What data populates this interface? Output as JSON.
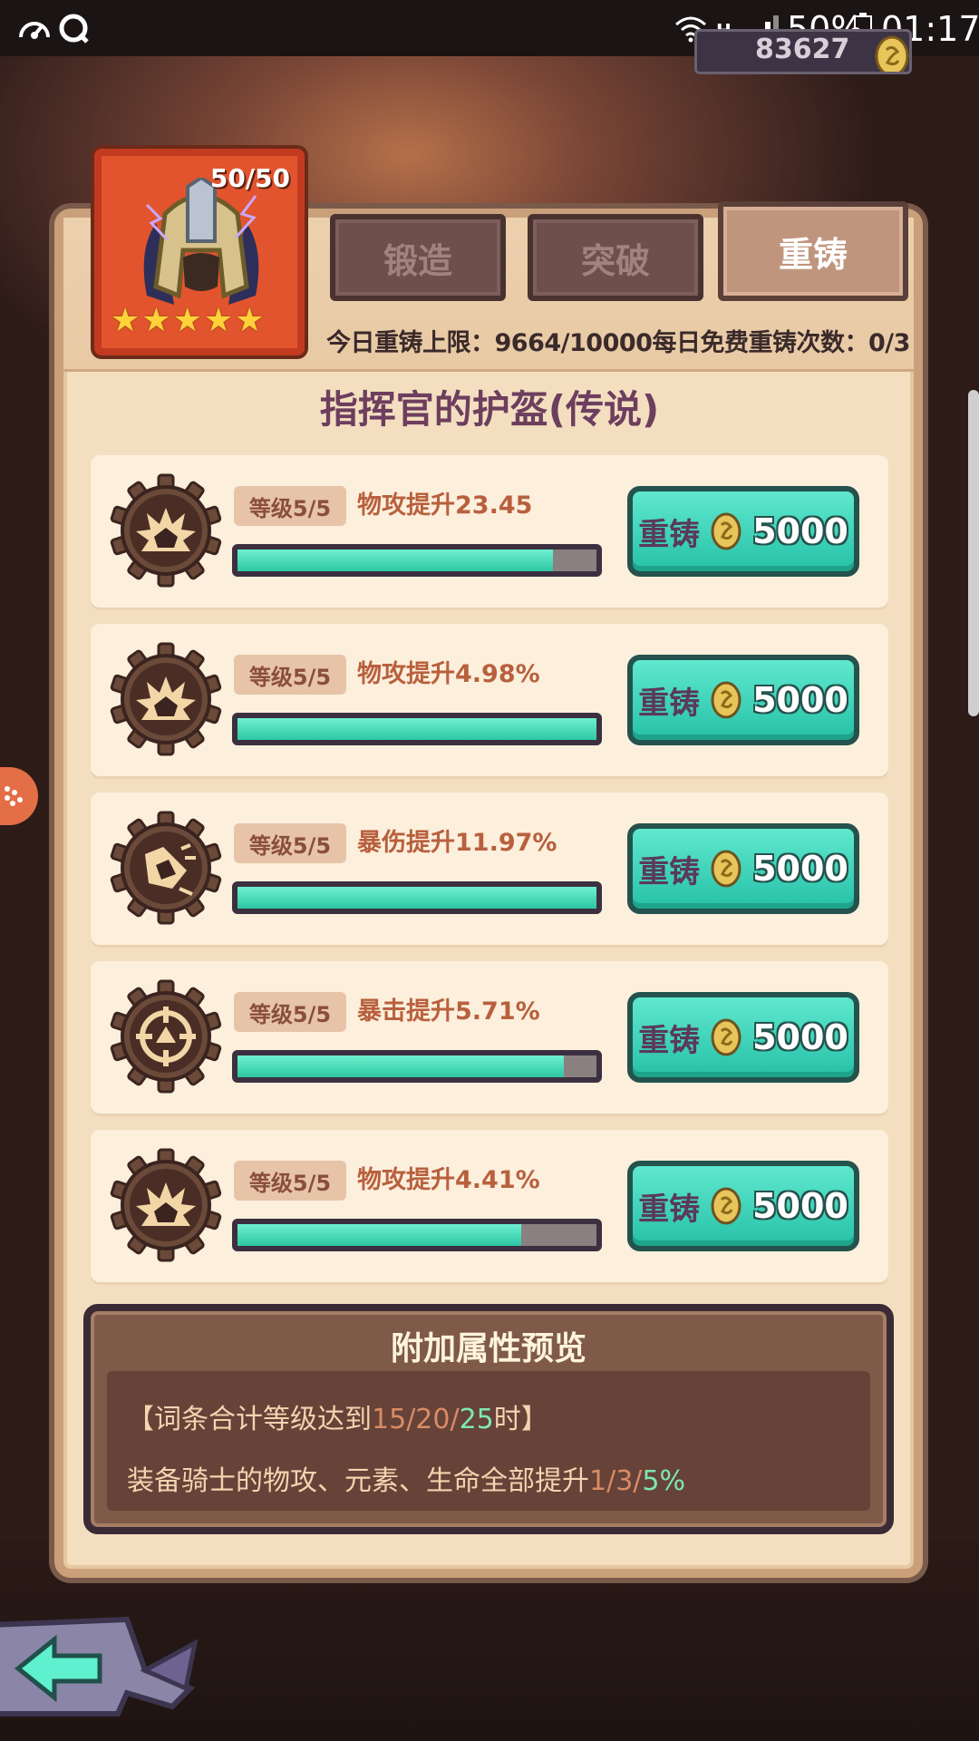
{
  "status_bar": {
    "network_type": "H",
    "battery": "50%",
    "time": "01:17"
  },
  "currency": {
    "amount": "83627"
  },
  "item": {
    "level": "50/50",
    "stars": 5,
    "title": "指挥官的护盔(传说)"
  },
  "tabs": [
    {
      "label": "锻造"
    },
    {
      "label": "突破"
    },
    {
      "label": "重铸"
    }
  ],
  "active_tab": "重铸",
  "limits": {
    "text": "今日重铸上限：9664/10000每日免费重铸次数：0/3"
  },
  "affixes": [
    {
      "level": "等级5/5",
      "stat": "物攻提升23.45",
      "progress": 0.88,
      "icon": "attack-burst-icon",
      "button": "重铸",
      "cost": "5000"
    },
    {
      "level": "等级5/5",
      "stat": "物攻提升4.98%",
      "progress": 1.0,
      "icon": "attack-burst-icon",
      "button": "重铸",
      "cost": "5000"
    },
    {
      "level": "等级5/5",
      "stat": "暴伤提升11.97%",
      "progress": 1.0,
      "icon": "crit-damage-icon",
      "button": "重铸",
      "cost": "5000"
    },
    {
      "level": "等级5/5",
      "stat": "暴击提升5.71%",
      "progress": 0.91,
      "icon": "crit-target-icon",
      "button": "重铸",
      "cost": "5000"
    },
    {
      "level": "等级5/5",
      "stat": "物攻提升4.41%",
      "progress": 0.79,
      "icon": "attack-burst-icon",
      "button": "重铸",
      "cost": "5000"
    }
  ],
  "preview": {
    "title": "附加属性预览",
    "line1_prefix": "【词条合计等级达到",
    "line1_tiers": [
      "15",
      "20",
      "25"
    ],
    "line1_suffix": "时】",
    "line2_prefix": "装备骑士的物攻、元素、生命全部提升",
    "line2_tiers": [
      "1",
      "3",
      "5"
    ],
    "line2_suffix": "%"
  },
  "colors": {
    "accent_teal": "#2cc7a4",
    "tier_low": "#d98b66",
    "tier_high": "#7ee8b0",
    "title_purple": "#6d3e5e"
  }
}
